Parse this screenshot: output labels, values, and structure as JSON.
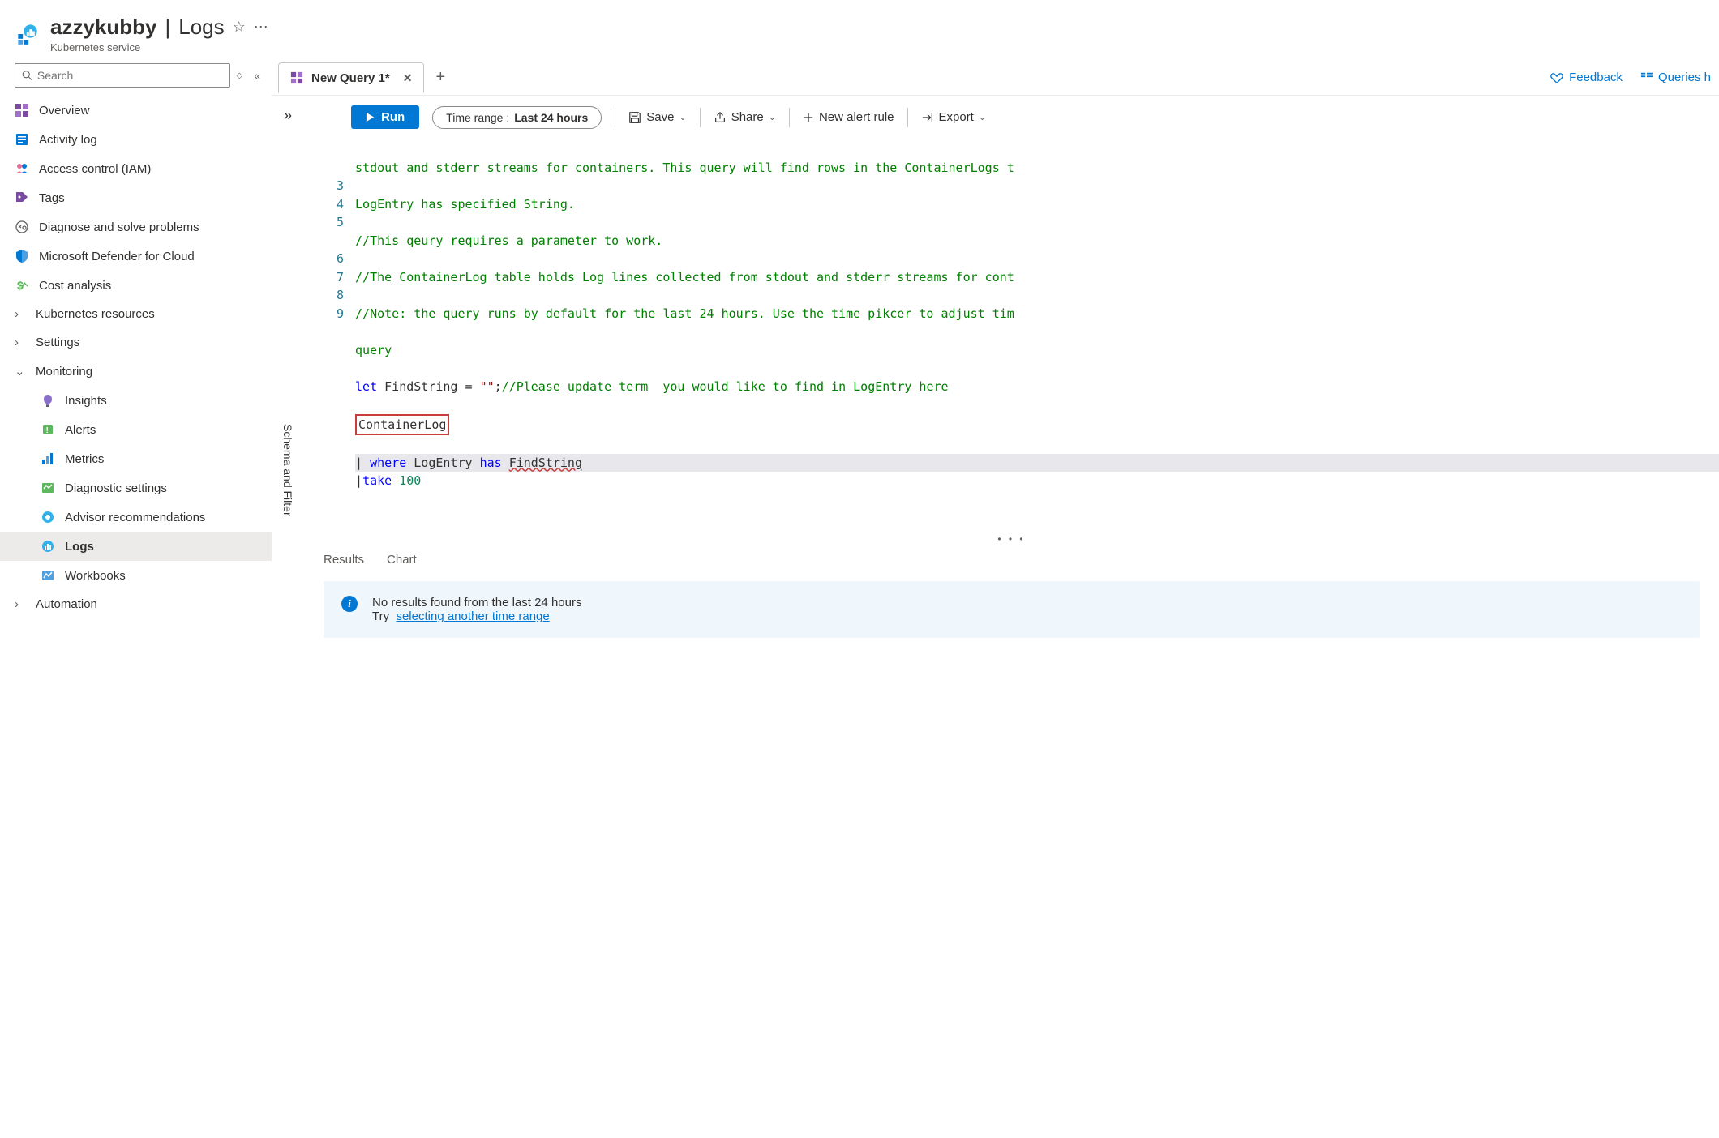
{
  "header": {
    "title_resource": "azzykubby",
    "title_section": "Logs",
    "subtitle": "Kubernetes service"
  },
  "search": {
    "placeholder": "Search"
  },
  "sidebar": {
    "items": [
      {
        "label": "Overview",
        "icon": "overview"
      },
      {
        "label": "Activity log",
        "icon": "activity"
      },
      {
        "label": "Access control (IAM)",
        "icon": "access"
      },
      {
        "label": "Tags",
        "icon": "tags"
      },
      {
        "label": "Diagnose and solve problems",
        "icon": "diagnose"
      },
      {
        "label": "Microsoft Defender for Cloud",
        "icon": "defender"
      },
      {
        "label": "Cost analysis",
        "icon": "cost"
      },
      {
        "label": "Kubernetes resources",
        "icon": "chevron"
      },
      {
        "label": "Settings",
        "icon": "chevron"
      },
      {
        "label": "Monitoring",
        "icon": "chevron-down"
      },
      {
        "label": "Insights",
        "icon": "insights",
        "indent": true
      },
      {
        "label": "Alerts",
        "icon": "alerts",
        "indent": true
      },
      {
        "label": "Metrics",
        "icon": "metrics",
        "indent": true
      },
      {
        "label": "Diagnostic settings",
        "icon": "diagsettings",
        "indent": true
      },
      {
        "label": "Advisor recommendations",
        "icon": "advisor",
        "indent": true
      },
      {
        "label": "Logs",
        "icon": "logs",
        "indent": true,
        "selected": true
      },
      {
        "label": "Workbooks",
        "icon": "workbooks",
        "indent": true
      },
      {
        "label": "Automation",
        "icon": "chevron"
      }
    ]
  },
  "tabs": {
    "active": "New Query 1*",
    "feedback": "Feedback",
    "queries": "Queries h"
  },
  "toolbar": {
    "run": "Run",
    "time_label": "Time range :",
    "time_value": "Last 24 hours",
    "save": "Save",
    "share": "Share",
    "new_alert": "New alert rule",
    "export": "Export"
  },
  "panel": {
    "schema_filter": "Schema and Filter"
  },
  "editor": {
    "lines": [
      "stdout and stderr streams for containers. This query will find rows in the ContainerLogs t",
      "LogEntry has specified String.",
      "//This qeury requires a parameter to work.",
      "//The ContainerLog table holds Log lines collected from stdout and stderr streams for cont",
      "//Note: the query runs by default for the last 24 hours. Use the time pikcer to adjust tim",
      "query",
      "let FindString = \"\";//Please update term  you would like to find in LogEntry here",
      "ContainerLog",
      "| where LogEntry has FindString",
      "|take 100"
    ],
    "line_numbers": [
      "",
      "",
      "3",
      "4",
      "5",
      "",
      "6",
      "7",
      "8",
      "9"
    ]
  },
  "results": {
    "tabs": {
      "results": "Results",
      "chart": "Chart"
    },
    "no_results": "No results found from the last 24 hours",
    "try": "Try",
    "link": "selecting another time range"
  }
}
